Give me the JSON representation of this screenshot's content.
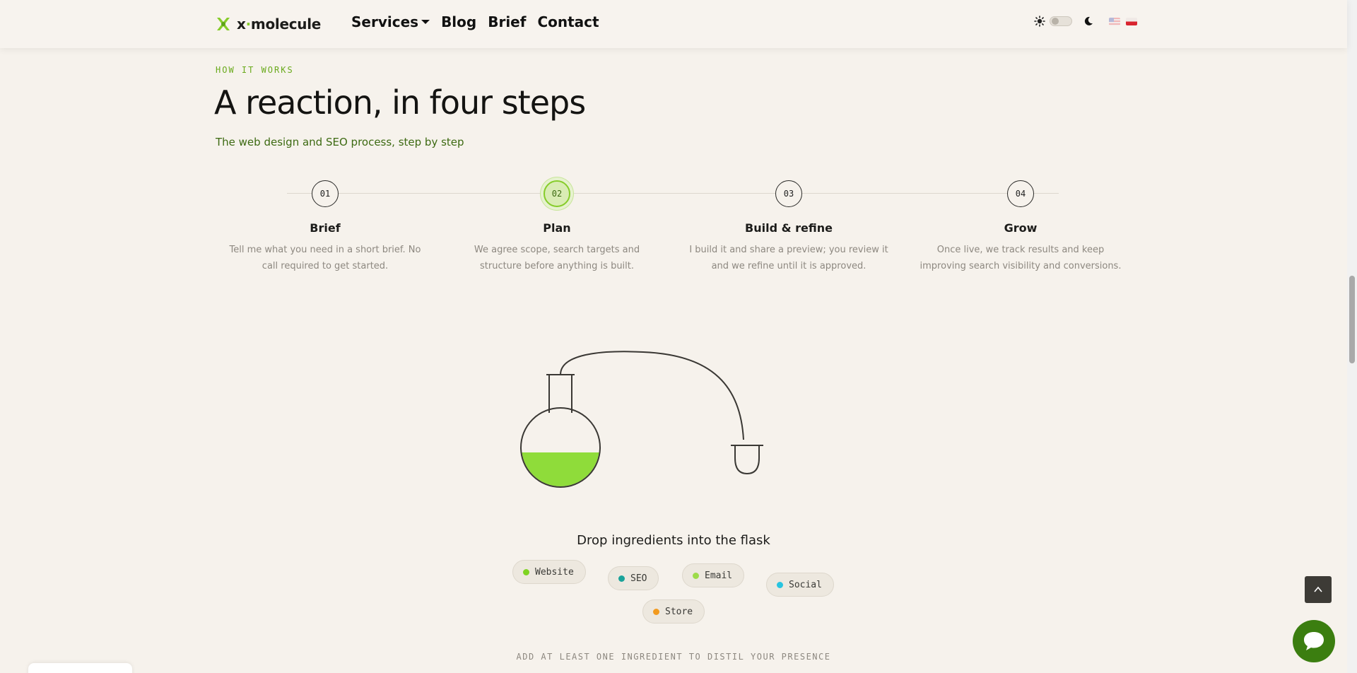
{
  "header": {
    "logo_text_a": "x",
    "logo_text_dot": "·",
    "logo_text_b": "molecule",
    "logo_icon": "molecule-x-icon",
    "nav": [
      {
        "label": "Services",
        "has_dropdown": true
      },
      {
        "label": "Blog"
      },
      {
        "label": "Brief"
      },
      {
        "label": "Contact"
      }
    ],
    "theme_toggle": {
      "state": "light",
      "icons": [
        "sun-icon",
        "moon-icon"
      ]
    },
    "languages": [
      "flag-us-icon",
      "flag-pl-icon"
    ]
  },
  "section": {
    "eyebrow": "HOW IT WORKS",
    "title": "A reaction, in four steps",
    "subtitle": "The web design and SEO process, step by step"
  },
  "steps": [
    {
      "number": "01",
      "title": "Brief",
      "desc": "Tell me what you need in a short brief. No call required to get started.",
      "active": false
    },
    {
      "number": "02",
      "title": "Plan",
      "desc": "We agree scope, search targets and structure before anything is built.",
      "active": true
    },
    {
      "number": "03",
      "title": "Build & refine",
      "desc": "I build it and share a preview; you review it and we refine until it is approved.",
      "active": false
    },
    {
      "number": "04",
      "title": "Grow",
      "desc": "Once live, we track results and keep improving search visibility and conversions.",
      "active": false
    }
  ],
  "reactor": {
    "flask_fill": "#8fdc3a",
    "title": "Drop ingredients into the flask",
    "ingredients": [
      {
        "label": "Website",
        "color": "#7ed321"
      },
      {
        "label": "SEO",
        "color": "#1aa39a"
      },
      {
        "label": "Email",
        "color": "#9ddb4a"
      },
      {
        "label": "Social",
        "color": "#28c4e0"
      },
      {
        "label": "Store",
        "color": "#f29a1e"
      }
    ],
    "hint": "ADD AT LEAST ONE INGREDIENT TO DISTIL YOUR PRESENCE"
  },
  "colors": {
    "accent": "#86cc2a",
    "accent_dark": "#3d6a12",
    "background": "#f6f2ec",
    "chat": "#3b7e10"
  }
}
